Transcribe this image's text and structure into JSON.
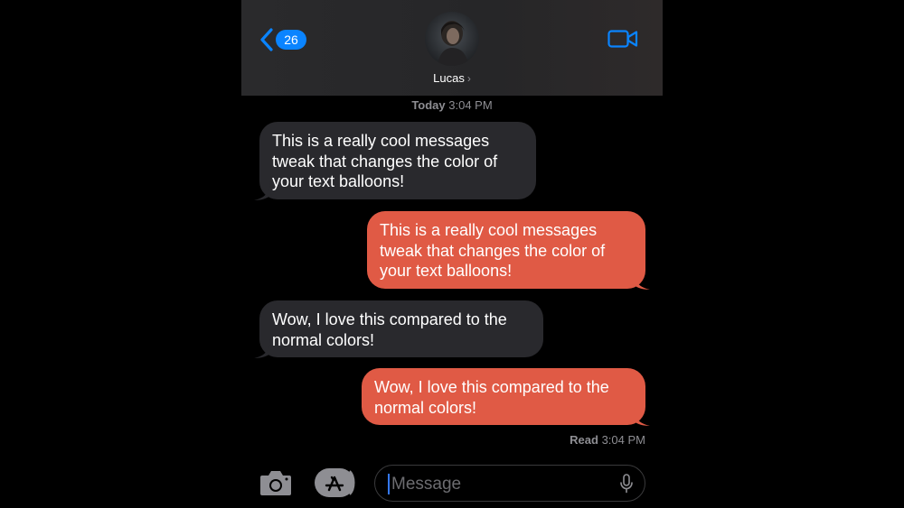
{
  "header": {
    "back_count": "26",
    "contact_name": "Lucas",
    "name_chevron": "›"
  },
  "timestamp": {
    "day": "Today",
    "time": "3:04 PM"
  },
  "messages": [
    {
      "direction": "received",
      "text": "This is a really cool messages tweak that changes the color of your text balloons!"
    },
    {
      "direction": "sent",
      "text": "This is a really cool messages tweak that changes the color of your text balloons!"
    },
    {
      "direction": "received",
      "text": "Wow, I love this compared to the normal colors!"
    },
    {
      "direction": "sent",
      "text": "Wow, I love this compared to the normal colors!"
    }
  ],
  "read_receipt": {
    "label": "Read",
    "time": "3:04 PM"
  },
  "composer": {
    "placeholder": "Message"
  },
  "icons": {
    "back": "chevron-left-icon",
    "facetime": "video-camera-icon",
    "camera": "camera-icon",
    "apps": "app-store-icon",
    "mic": "microphone-icon"
  },
  "colors": {
    "accent": "#0a84ff",
    "received_bubble": "#29292d",
    "sent_bubble": "#e05a45",
    "background": "#000000"
  }
}
